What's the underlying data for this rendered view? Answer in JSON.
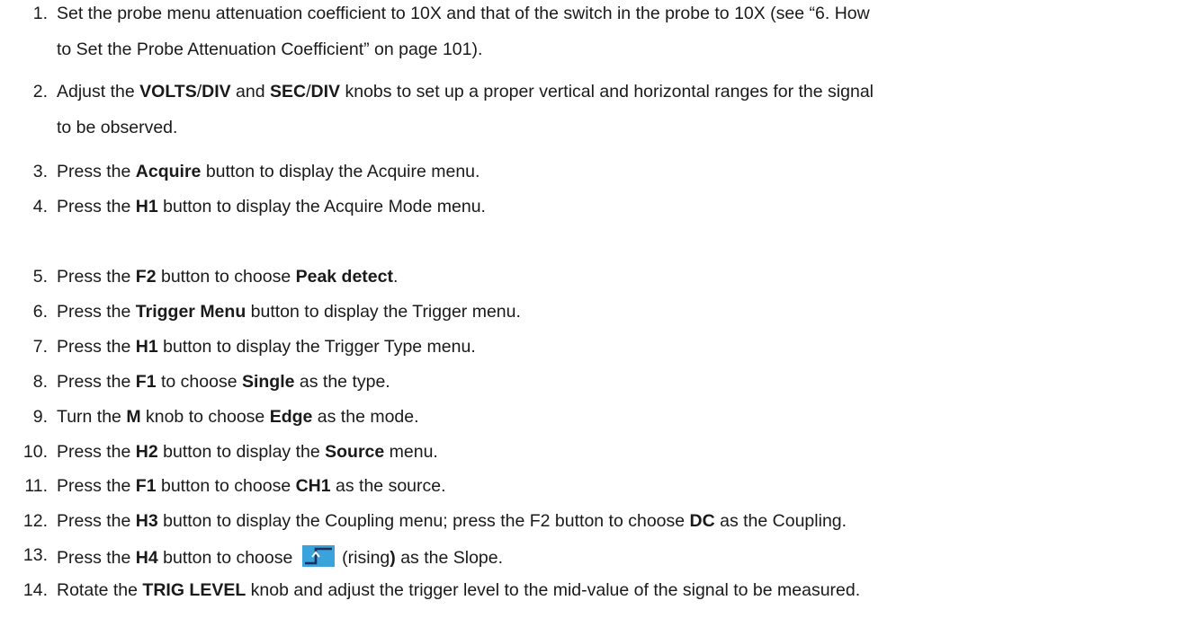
{
  "steps": [
    {
      "num": "1.",
      "lines": [
        [
          {
            "t": "Set the probe menu attenuation coefficient to 10X and that of the switch in the probe to 10X (see “6. How"
          }
        ],
        [
          {
            "t": "to Set the Probe Attenuation Coefficient” on page 101)."
          }
        ]
      ]
    },
    {
      "num": "2.",
      "lines": [
        [
          {
            "t": "Adjust the "
          },
          {
            "t": "VOLTS",
            "b": true
          },
          {
            "t": "/"
          },
          {
            "t": "DIV",
            "b": true
          },
          {
            "t": " and "
          },
          {
            "t": "SEC",
            "b": true
          },
          {
            "t": "/"
          },
          {
            "t": "DIV",
            "b": true
          },
          {
            "t": " knobs to set up a proper vertical and horizontal ranges for the signal"
          }
        ],
        [
          {
            "t": "to be observed."
          }
        ]
      ]
    },
    {
      "num": "3.",
      "lines": [
        [
          {
            "t": "Press the "
          },
          {
            "t": "Acquire",
            "b": true
          },
          {
            "t": " button to display the Acquire menu."
          }
        ]
      ]
    },
    {
      "num": "4.",
      "lines": [
        [
          {
            "t": "Press the "
          },
          {
            "t": "H1",
            "b": true
          },
          {
            "t": " button to display the Acquire Mode menu."
          }
        ]
      ]
    },
    {
      "num": "5.",
      "lines": [
        [
          {
            "t": "Press the "
          },
          {
            "t": "F2",
            "b": true
          },
          {
            "t": " button to choose "
          },
          {
            "t": "Peak detect",
            "b": true
          },
          {
            "t": "."
          }
        ]
      ]
    },
    {
      "num": "6.",
      "lines": [
        [
          {
            "t": "Press the "
          },
          {
            "t": "Trigger Menu",
            "b": true
          },
          {
            "t": " button to display the Trigger menu."
          }
        ]
      ]
    },
    {
      "num": "7.",
      "lines": [
        [
          {
            "t": "Press the "
          },
          {
            "t": "H1",
            "b": true
          },
          {
            "t": " button to display the Trigger Type menu."
          }
        ]
      ]
    },
    {
      "num": "8.",
      "lines": [
        [
          {
            "t": "Press the "
          },
          {
            "t": "F1",
            "b": true
          },
          {
            "t": " to choose "
          },
          {
            "t": "Single",
            "b": true
          },
          {
            "t": " as the type."
          }
        ]
      ]
    },
    {
      "num": "9.",
      "lines": [
        [
          {
            "t": "Turn the "
          },
          {
            "t": "M",
            "b": true
          },
          {
            "t": " knob to choose "
          },
          {
            "t": "Edge",
            "b": true
          },
          {
            "t": " as the mode."
          }
        ]
      ]
    },
    {
      "num": "10.",
      "lines": [
        [
          {
            "t": "Press the "
          },
          {
            "t": "H2",
            "b": true
          },
          {
            "t": " button to display the "
          },
          {
            "t": "Source",
            "b": true
          },
          {
            "t": " menu."
          }
        ]
      ]
    },
    {
      "num": "11.",
      "lines": [
        [
          {
            "t": "Press the "
          },
          {
            "t": "F1",
            "b": true
          },
          {
            "t": " button to choose "
          },
          {
            "t": "CH1",
            "b": true
          },
          {
            "t": " as the source."
          }
        ]
      ]
    },
    {
      "num": "12.",
      "lines": [
        [
          {
            "t": "Press the "
          },
          {
            "t": "H3",
            "b": true
          },
          {
            "t": " button to display the Coupling menu; press the F2 button to choose "
          },
          {
            "t": "DC",
            "b": true
          },
          {
            "t": " as the Coupling."
          }
        ]
      ]
    },
    {
      "num": "13.",
      "lines": [
        [
          {
            "t": "Press the "
          },
          {
            "t": "H4",
            "b": true
          },
          {
            "t": " button to choose "
          },
          {
            "icon": "rising-edge-icon"
          },
          {
            "t": " (rising"
          },
          {
            "t": ")",
            "b": true
          },
          {
            "t": " as the Slope."
          }
        ]
      ]
    },
    {
      "num": "14.",
      "lines": [
        [
          {
            "t": "Rotate the "
          },
          {
            "t": "TRIG LEVEL",
            "b": true
          },
          {
            "t": " knob and adjust the trigger level to the mid-value of the signal to be measured."
          }
        ]
      ]
    }
  ],
  "colors": {
    "text": "#1a1a1a",
    "icon_bg": "#3aa3dc",
    "icon_line": "#1d2f5a"
  }
}
